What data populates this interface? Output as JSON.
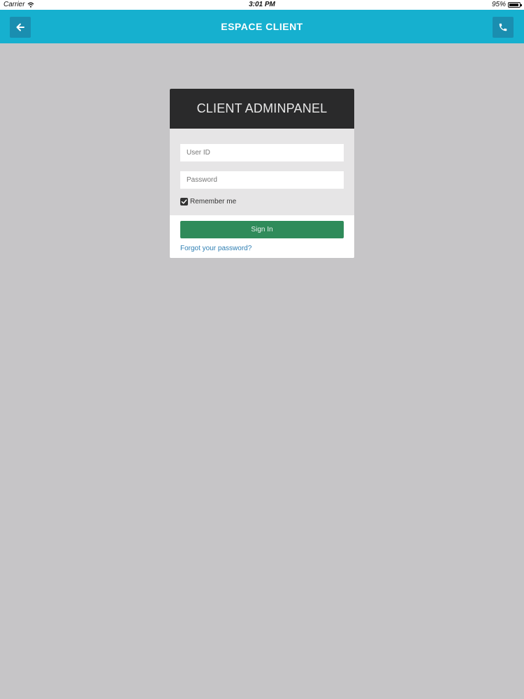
{
  "status_bar": {
    "carrier": "Carrier",
    "time": "3:01 PM",
    "battery": "95%"
  },
  "nav": {
    "title": "ESPACE CLIENT",
    "back_icon": "arrow-left-icon",
    "call_icon": "phone-icon"
  },
  "panel": {
    "title": "CLIENT ADMINPANEL",
    "user_id_placeholder": "User ID",
    "password_placeholder": "Password",
    "user_id_value": "",
    "password_value": "",
    "remember_label": "Remember me",
    "remember_checked": true,
    "sign_in_label": "Sign In",
    "forgot_label": "Forgot your password?"
  },
  "colors": {
    "nav_background": "#16b0cf",
    "nav_button": "#1a8eb0",
    "page_background": "#c6c5c7",
    "panel_header": "#2a2a2b",
    "sign_in_button": "#2f8b5a",
    "link": "#2f7fb3"
  }
}
